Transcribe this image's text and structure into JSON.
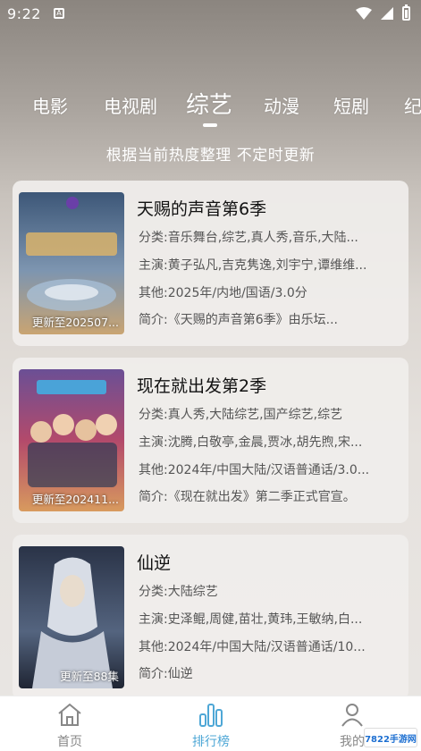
{
  "status": {
    "time": "9:22",
    "notif": "A"
  },
  "tabs": [
    {
      "label": "电影"
    },
    {
      "label": "电视剧"
    },
    {
      "label": "综艺"
    },
    {
      "label": "动漫"
    },
    {
      "label": "短剧"
    },
    {
      "label": "纪"
    }
  ],
  "subtitle": "根据当前热度整理 不定时更新",
  "cards": [
    {
      "title": "天赐的声音第6季",
      "update": "更新至202507...",
      "genre_label": "分类:",
      "genre": "音乐舞台,综艺,真人秀,音乐,大陆...",
      "cast_label": "主演:",
      "cast": "黄子弘凡,吉克隽逸,刘宇宁,谭维维...",
      "other_label": "其他:",
      "other": "2025年/内地/国语/3.0分",
      "intro_label": "简介:",
      "intro": "《天赐的声音第6季》由乐坛...",
      "poster_colors": [
        "#4a6a8a",
        "#6d86a3",
        "#c89f6a"
      ]
    },
    {
      "title": "现在就出发第2季",
      "update": "更新至202411...",
      "genre_label": "分类:",
      "genre": "真人秀,大陆综艺,国产综艺,综艺",
      "cast_label": "主演:",
      "cast": "沈腾,白敬亭,金晨,贾冰,胡先煦,宋...",
      "other_label": "其他:",
      "other": "2024年/中国大陆/汉语普通话/3.0...",
      "intro_label": "简介:",
      "intro": "《现在就出发》第二季正式官宣。",
      "poster_colors": [
        "#7d5a8f",
        "#b5476a",
        "#d28e53"
      ]
    },
    {
      "title": "仙逆",
      "update": "更新至88集",
      "genre_label": "分类:",
      "genre": "大陆综艺",
      "cast_label": "主演:",
      "cast": "史泽鲲,周健,苗壮,黄玮,王敏纳,白...",
      "other_label": "其他:",
      "other": "2024年/中国大陆/汉语普通话/10...",
      "intro_label": "简介:",
      "intro": "仙逆",
      "poster_colors": [
        "#2f3a4f",
        "#5a6b88",
        "#c7ccd6"
      ]
    }
  ],
  "nav": {
    "home": "首页",
    "rank": "排行榜",
    "mine": "我的"
  },
  "watermark": "7822手游网"
}
